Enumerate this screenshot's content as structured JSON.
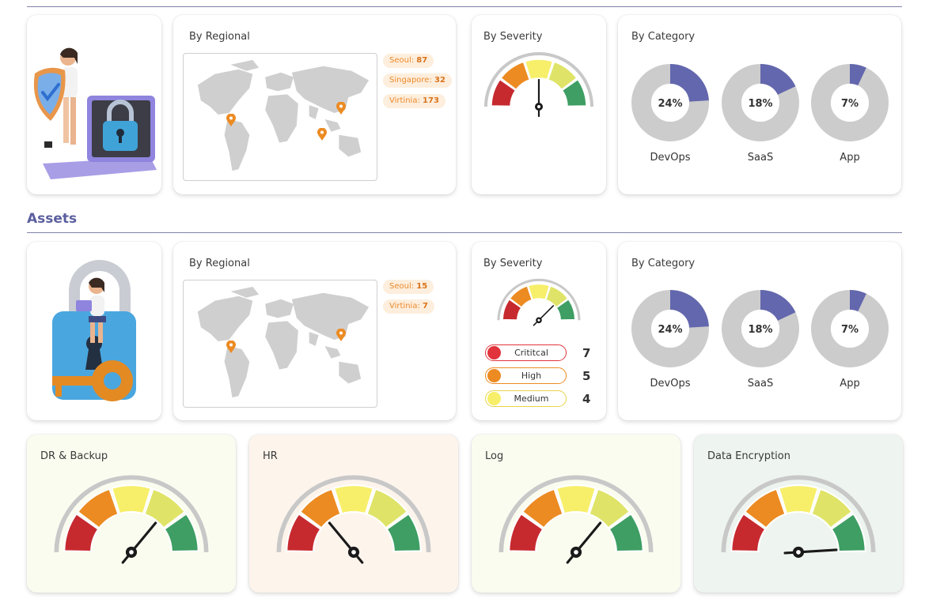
{
  "colors": {
    "accent": "#6367ad",
    "donut_fill": "#6367ad",
    "donut_track": "#cccccc",
    "gauge_red": "#c62a2f",
    "gauge_orange": "#ec8b22",
    "gauge_yellow": "#f7ef6a",
    "gauge_lime": "#dfe468",
    "gauge_green": "#3e9e63",
    "pin": "#ec8b22"
  },
  "top_row": {
    "regional": {
      "title": "By Regional",
      "pins": [
        {
          "label": "Seoul",
          "value": "87"
        },
        {
          "label": "Singapore",
          "value": "32"
        },
        {
          "label": "Virtinia",
          "value": "173"
        }
      ]
    },
    "severity": {
      "title": "By Severity",
      "needle_level": 0.5
    },
    "category": {
      "title": "By Category",
      "items": [
        {
          "label": "DevOps",
          "percent_text": "24%",
          "value": 0.24
        },
        {
          "label": "SaaS",
          "percent_text": "18%",
          "value": 0.18
        },
        {
          "label": "App",
          "percent_text": "7%",
          "value": 0.07
        }
      ]
    }
  },
  "assets": {
    "title": "Assets",
    "regional": {
      "title": "By Regional",
      "pins": [
        {
          "label": "Seoul",
          "value": "15"
        },
        {
          "label": "Virtinia",
          "value": "7"
        }
      ]
    },
    "severity": {
      "title": "By Severity",
      "needle_level": 0.75,
      "legend": [
        {
          "label": "Crititcal",
          "count": "7",
          "color": "#e1343c"
        },
        {
          "label": "High",
          "count": "5",
          "color": "#ec8b22"
        },
        {
          "label": "Medium",
          "count": "4",
          "color": "#f7ef6a"
        }
      ]
    },
    "category": {
      "title": "By Category",
      "items": [
        {
          "label": "DevOps",
          "percent_text": "24%",
          "value": 0.24
        },
        {
          "label": "SaaS",
          "percent_text": "18%",
          "value": 0.18
        },
        {
          "label": "App",
          "percent_text": "7%",
          "value": 0.07
        }
      ]
    }
  },
  "bottom_gauges": [
    {
      "title": "DR & Backup",
      "needle_level": 0.72,
      "background": "#fafcef"
    },
    {
      "title": "HR",
      "needle_level": 0.28,
      "background": "#fdf4ec"
    },
    {
      "title": "Log",
      "needle_level": 0.72,
      "background": "#fafcef"
    },
    {
      "title": "Data Encryption",
      "needle_level": 0.98,
      "background": "#eef4ef"
    }
  ]
}
